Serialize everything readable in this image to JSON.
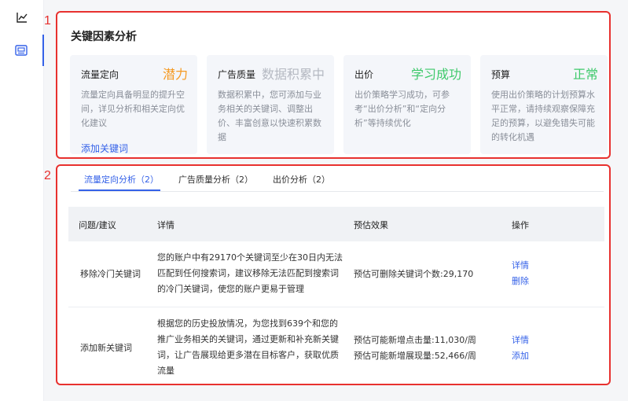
{
  "markers": {
    "panel_one": "1",
    "panel_two": "2"
  },
  "key_factors": {
    "title": "关键因素分析",
    "cards": [
      {
        "name": "流量定向",
        "status": "潜力",
        "status_color": "#f59a23",
        "desc": "流量定向具备明显的提升空间，详见分析和相关定向优化建议",
        "link": "添加关键词"
      },
      {
        "name": "广告质量",
        "status": "数据积累中",
        "status_color": "#b5b9c2",
        "desc": "数据积累中，您可添加与业务相关的关键词、调整出价、丰富创意以快速积累数据",
        "link": ""
      },
      {
        "name": "出价",
        "status": "学习成功",
        "status_color": "#3ec96b",
        "desc": "出价策略学习成功，可参考“出价分析”和“定向分析”等持续优化",
        "link": ""
      },
      {
        "name": "预算",
        "status": "正常",
        "status_color": "#3ec96b",
        "desc": "使用出价策略的计划预算水平正常，请持续观察保障充足的预算，以避免错失可能的转化机遇",
        "link": ""
      }
    ]
  },
  "tabs": [
    {
      "label": "流量定向分析（2）"
    },
    {
      "label": "广告质量分析（2）"
    },
    {
      "label": "出价分析（2）"
    }
  ],
  "table": {
    "headers": {
      "issue": "问题/建议",
      "detail": "详情",
      "effect": "预估效果",
      "action": "操作"
    },
    "rows": [
      {
        "issue": "移除冷门关键词",
        "detail": "您的账户中有29170个关键词至少在30日内无法匹配到任何搜索词，建议移除无法匹配到搜索词的冷门关键词，使您的账户更易于管理",
        "effects": [
          "预估可删除关键词个数:29,170"
        ],
        "actions": [
          "详情",
          "删除"
        ]
      },
      {
        "issue": "添加新关键词",
        "detail": "根据您的历史投放情况，为您找到639个和您的推广业务相关的关键词，通过更新和补充新关键词，让广告展现给更多潜在目标客户，获取优质流量",
        "effects": [
          "预估可能新增点击量:11,030/周",
          "预估可能新增展现量:52,466/周"
        ],
        "actions": [
          "详情",
          "添加"
        ]
      }
    ]
  }
}
